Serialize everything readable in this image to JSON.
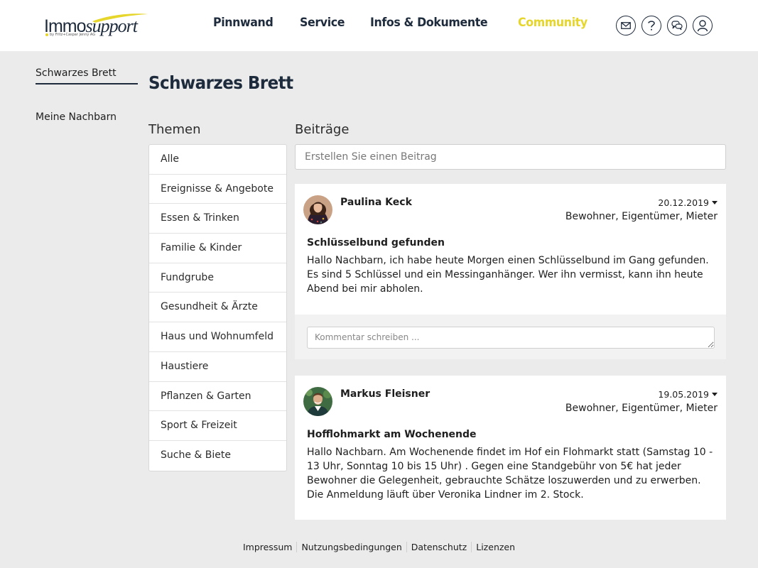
{
  "brand": {
    "name_main": "Immo",
    "name_italic": "support",
    "subtitle": "by Fritz+Caspar Jenny AG",
    "accent_color": "#e6d52b",
    "primary_color": "#1e2b3c"
  },
  "nav": {
    "items": [
      {
        "label": "Pinnwand",
        "active": false
      },
      {
        "label": "Service",
        "active": false
      },
      {
        "label": "Infos & Dokumente",
        "active": false
      },
      {
        "label": "Community",
        "active": true
      }
    ]
  },
  "header_icons": [
    "mail-icon",
    "help-icon",
    "chat-icon",
    "user-icon"
  ],
  "subnav": {
    "items": [
      {
        "label": "Schwarzes Brett",
        "active": true
      },
      {
        "label": "Meine Nachbarn",
        "active": false
      }
    ]
  },
  "page_title": "Schwarzes Brett",
  "themen": {
    "heading": "Themen",
    "items": [
      "Alle",
      "Ereignisse & Angebote",
      "Essen & Trinken",
      "Familie & Kinder",
      "Fundgrube",
      "Gesundheit & Ärzte",
      "Haus und Wohnumfeld",
      "Haustiere",
      "Pflanzen & Garten",
      "Sport & Freizeit",
      "Suche & Biete"
    ]
  },
  "beitraege": {
    "heading": "Beiträge",
    "create_placeholder": "Erstellen Sie einen Beitrag",
    "posts": [
      {
        "author": "Paulina Keck",
        "date": "20.12.2019",
        "roles": "Bewohner, Eigentümer, Mieter",
        "title": "Schlüsselbund gefunden",
        "body": "Hallo Nachbarn, ich habe heute Morgen einen Schlüsselbund im Gang gefunden. Es sind 5 Schlüssel und ein Messinganhänger. Wer ihn vermisst, kann ihn heute Abend bei mir abholen.",
        "comment_placeholder": "Kommentar schreiben ..."
      },
      {
        "author": "Markus Fleisner",
        "date": "19.05.2019",
        "roles": "Bewohner, Eigentümer, Mieter",
        "title": "Hofflohmarkt am Wochenende",
        "body": "Hallo Nachbarn. Am Wochenende findet im Hof ein Flohmarkt statt (Samstag 10 - 13 Uhr, Sonntag 10 bis 15 Uhr) . Gegen eine Standgebühr von 5€ hat jeder Bewohner die Gelegenheit, gebrauchte Schätze loszuwerden und zu erwerben. Die Anmeldung läuft über Veronika Lindner im 2. Stock."
      }
    ]
  },
  "footer": {
    "links": [
      "Impressum",
      "Nutzungsbedingungen",
      "Datenschutz",
      "Lizenzen"
    ]
  }
}
